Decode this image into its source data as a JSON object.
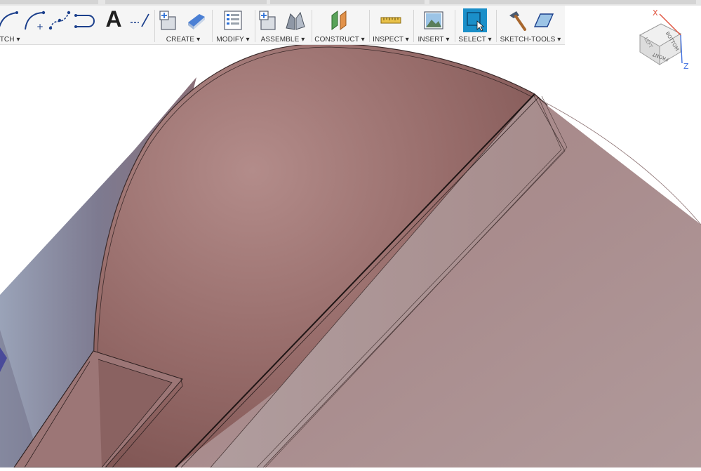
{
  "toolbar": {
    "groups": [
      {
        "label": "SKETCH ▾",
        "icons": [
          "arc-icon",
          "spline-icon",
          "fit-point-spline-icon",
          "slot-icon",
          "text-icon",
          "dimension-icon"
        ]
      },
      {
        "label": "CREATE ▾",
        "icons": [
          "new-component-icon",
          "extrude-icon"
        ]
      },
      {
        "label": "MODIFY ▾",
        "icons": [
          "parameters-icon"
        ]
      },
      {
        "label": "ASSEMBLE ▾",
        "icons": [
          "new-component-icon",
          "joint-icon"
        ]
      },
      {
        "label": "CONSTRUCT ▾",
        "icons": [
          "offset-plane-icon"
        ]
      },
      {
        "label": "INSPECT ▾",
        "icons": [
          "measure-icon"
        ]
      },
      {
        "label": "INSERT ▾",
        "icons": [
          "insert-image-icon"
        ]
      },
      {
        "label": "SELECT ▾",
        "icons": [
          "window-select-icon"
        ]
      },
      {
        "label": "SKETCH-TOOLS ▾",
        "icons": [
          "hammer-icon",
          "sketch-plane-icon"
        ]
      }
    ],
    "text_tool_glyph": "A"
  },
  "viewcube": {
    "faces": [
      "BOTTOM",
      "FRONT",
      "LEFT"
    ],
    "axes": [
      "X",
      "Z"
    ]
  },
  "colors": {
    "toolbar_bg": "#f5f5f5",
    "body_face": "#9a6f6e",
    "body_side": "#a5898a",
    "axis_x": "#e0533f",
    "axis_z": "#3f6fe0",
    "select_active": "#1a8fc9"
  }
}
